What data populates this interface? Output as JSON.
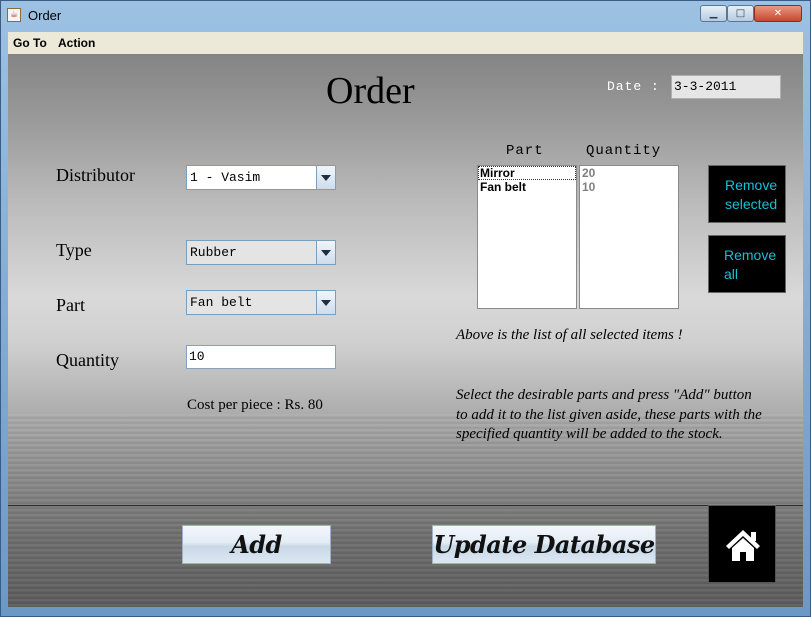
{
  "window": {
    "title": "Order"
  },
  "menu": {
    "items": [
      "Go To",
      "Action"
    ]
  },
  "heading": "Order",
  "date": {
    "label": "Date :",
    "value": "3-3-2011"
  },
  "form": {
    "distributor_label": "Distributor",
    "distributor_value": "1 - Vasim",
    "type_label": "Type",
    "type_value": "Rubber",
    "part_label": "Part",
    "part_value": "Fan belt",
    "quantity_label": "Quantity",
    "quantity_value": "10",
    "cost_text": "Cost per piece : Rs. 80"
  },
  "list": {
    "part_header": "Part",
    "quantity_header": "Quantity",
    "parts": [
      "Mirror",
      "Fan belt"
    ],
    "quantities": [
      "20",
      "10"
    ]
  },
  "buttons": {
    "remove_selected": [
      "Remove",
      "selected"
    ],
    "remove_all": [
      "Remove",
      "all"
    ],
    "add": "Add",
    "update": "Update Database"
  },
  "notes": {
    "list_note": "Above is the list of all selected items !",
    "instruction": "Select the desirable parts and press \"Add\" button to add it to the list given aside, these parts with the specified quantity will be added to the stock."
  },
  "icons": {
    "app": "java-cup-icon",
    "home": "home-icon"
  }
}
